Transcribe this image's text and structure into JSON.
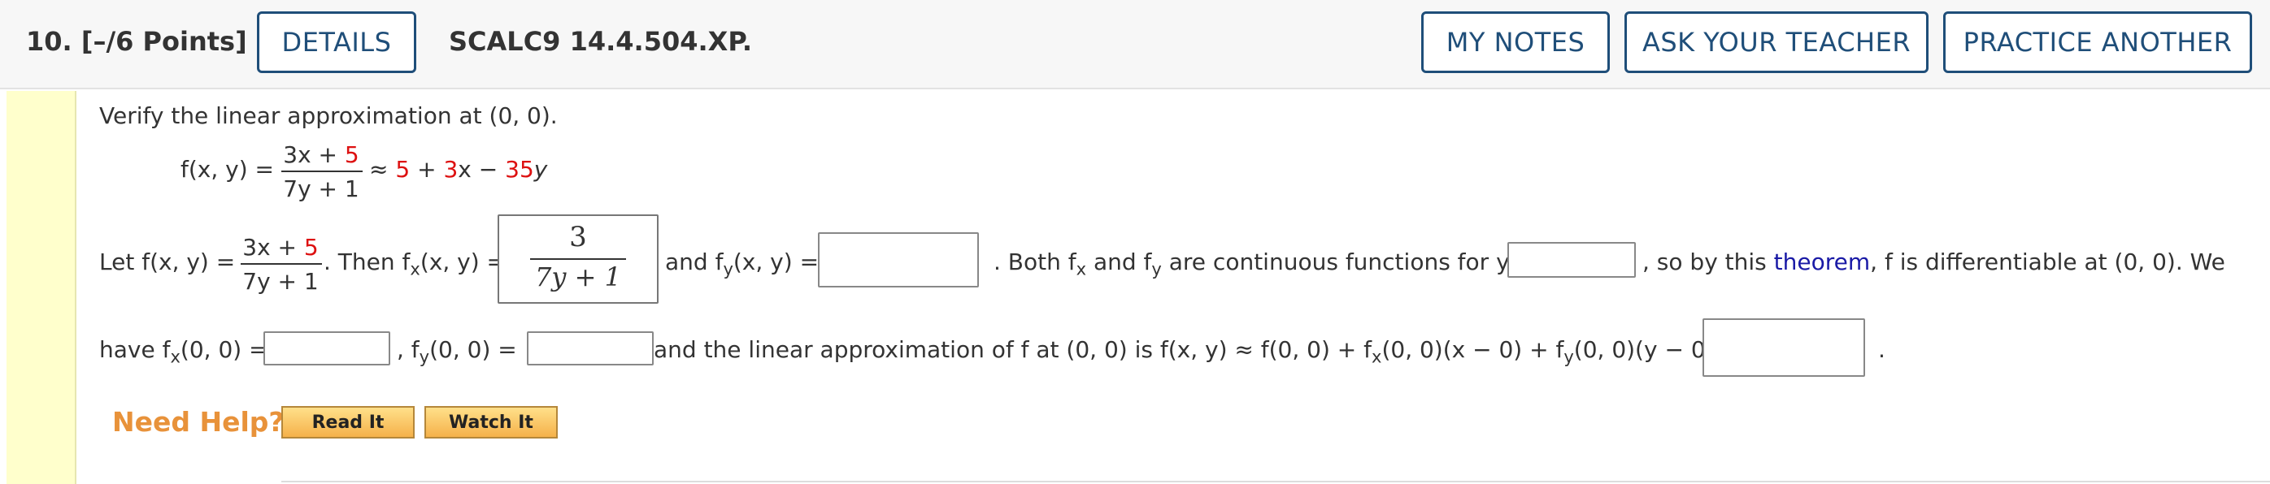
{
  "header": {
    "question_number": "10.",
    "points": "[–/6 Points]",
    "details_label": "DETAILS",
    "problem_code": "SCALC9 14.4.504.XP.",
    "my_notes_label": "MY NOTES",
    "ask_teacher_label": "ASK YOUR TEACHER",
    "practice_another_label": "PRACTICE ANOTHER"
  },
  "problem": {
    "intro": "Verify the linear approximation at (0, 0).",
    "f_label": "f(x, y) =",
    "num_a": "3x + ",
    "num_b": "5",
    "den": "7y + 1",
    "approx_a": "≈ ",
    "approx_b": "5",
    "approx_c": " + ",
    "approx_d": "3",
    "approx_e": "x − ",
    "approx_f": "35",
    "approx_g": "y",
    "let": "Let f(x, y) =",
    "then": ". Then f",
    "fx_arg": "(x, y) =",
    "fx_answer_num": "3",
    "fx_answer_den": "7y + 1",
    "and": "and f",
    "fy_arg": "(x, y) =",
    "both": ". Both f",
    "and2": " and f",
    "cont": " are continuous functions for y ≠",
    "so_by": ", so by this ",
    "theorem": "theorem",
    "differentiable": ", f is differentiable at (0, 0). We",
    "have": "have f",
    "fx00": "(0, 0) =",
    "comma_fy": ", f",
    "fy00": "(0, 0) =",
    "linear": "and the linear approximation of f at (0, 0) is f(x, y) ≈ f(0, 0) + f",
    "lin_mid": "(0, 0)(x − 0) + f",
    "lin_end": "(0, 0)(y − 0) =",
    "period": ".",
    "sub_x": "x",
    "sub_y": "y"
  },
  "help": {
    "need_help": "Need Help?",
    "read_it": "Read It",
    "watch_it": "Watch It"
  }
}
